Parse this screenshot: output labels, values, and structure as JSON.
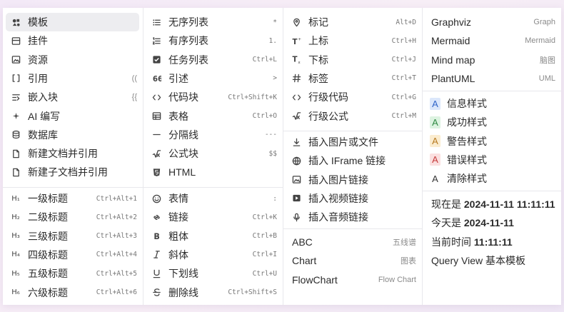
{
  "col1": {
    "block_items": [
      {
        "name": "template",
        "icon": "template-icon",
        "label": "模板",
        "hint": ""
      },
      {
        "name": "widget",
        "icon": "widget-icon",
        "label": "挂件",
        "hint": ""
      },
      {
        "name": "asset",
        "icon": "image-icon",
        "label": "资源",
        "hint": ""
      },
      {
        "name": "ref",
        "icon": "brackets-icon",
        "label": "引用",
        "hint": "(("
      },
      {
        "name": "embed",
        "icon": "embed-icon",
        "label": "嵌入块",
        "hint": "{{"
      },
      {
        "name": "ai",
        "icon": "sparkle-icon",
        "label": "AI 编写",
        "hint": ""
      },
      {
        "name": "database",
        "icon": "database-icon",
        "label": "数据库",
        "hint": ""
      },
      {
        "name": "new-doc-ref",
        "icon": "document-icon",
        "label": "新建文档并引用",
        "hint": ""
      },
      {
        "name": "new-subdoc-ref",
        "icon": "document-icon",
        "label": "新建子文档并引用",
        "hint": ""
      }
    ],
    "headings": [
      {
        "glyph": "H₁",
        "label": "一级标题",
        "shortcut": "Ctrl+Alt+1"
      },
      {
        "glyph": "H₂",
        "label": "二级标题",
        "shortcut": "Ctrl+Alt+2"
      },
      {
        "glyph": "H₃",
        "label": "三级标题",
        "shortcut": "Ctrl+Alt+3"
      },
      {
        "glyph": "H₄",
        "label": "四级标题",
        "shortcut": "Ctrl+Alt+4"
      },
      {
        "glyph": "H₅",
        "label": "五级标题",
        "shortcut": "Ctrl+Alt+5"
      },
      {
        "glyph": "H₆",
        "label": "六级标题",
        "shortcut": "Ctrl+Alt+6"
      }
    ]
  },
  "col2": {
    "blocks": [
      {
        "name": "unordered-list",
        "icon": "list-icon",
        "label": "无序列表",
        "shortcut": "*"
      },
      {
        "name": "ordered-list",
        "icon": "ordered-list-icon",
        "label": "有序列表",
        "shortcut": "1."
      },
      {
        "name": "task-list",
        "icon": "checkbox-icon",
        "label": "任务列表",
        "shortcut": "Ctrl+L"
      },
      {
        "name": "quote",
        "icon": "quote-icon",
        "label": "引述",
        "shortcut": ">"
      },
      {
        "name": "code-block",
        "icon": "code-icon",
        "label": "代码块",
        "shortcut": "Ctrl+Shift+K"
      },
      {
        "name": "table",
        "icon": "table-icon",
        "label": "表格",
        "shortcut": "Ctrl+O"
      },
      {
        "name": "divider",
        "icon": "divider-icon",
        "label": "分隔线",
        "shortcut": "---"
      },
      {
        "name": "math-block",
        "icon": "math-icon",
        "label": "公式块",
        "shortcut": "$$"
      },
      {
        "name": "html",
        "icon": "html-icon",
        "label": "HTML",
        "shortcut": ""
      }
    ],
    "inline": [
      {
        "name": "emoji",
        "icon": "emoji-icon",
        "label": "表情",
        "shortcut": ":"
      },
      {
        "name": "link",
        "icon": "link-icon",
        "label": "链接",
        "shortcut": "Ctrl+K"
      },
      {
        "name": "bold",
        "icon": "bold-icon",
        "label": "粗体",
        "shortcut": "Ctrl+B"
      },
      {
        "name": "italic",
        "icon": "italic-icon",
        "label": "斜体",
        "shortcut": "Ctrl+I"
      },
      {
        "name": "underline",
        "icon": "underline-icon",
        "label": "下划线",
        "shortcut": "Ctrl+U"
      },
      {
        "name": "strikethrough",
        "icon": "strikethrough-icon",
        "label": "删除线",
        "shortcut": "Ctrl+Shift+S"
      }
    ]
  },
  "col3": {
    "inline": [
      {
        "name": "mark",
        "icon": "marker-icon",
        "label": "标记",
        "shortcut": "Alt+D"
      },
      {
        "name": "superscript",
        "icon": "superscript-icon",
        "label": "上标",
        "shortcut": "Ctrl+H"
      },
      {
        "name": "subscript",
        "icon": "subscript-icon",
        "label": "下标",
        "shortcut": "Ctrl+J"
      },
      {
        "name": "tag",
        "icon": "hash-icon",
        "label": "标签",
        "shortcut": "Ctrl+T"
      },
      {
        "name": "inline-code",
        "icon": "code-icon",
        "label": "行级代码",
        "shortcut": "Ctrl+G"
      },
      {
        "name": "inline-math",
        "icon": "math-icon",
        "label": "行级公式",
        "shortcut": "Ctrl+M"
      }
    ],
    "media": [
      {
        "name": "insert-image-file",
        "icon": "download-icon",
        "label": "插入图片或文件"
      },
      {
        "name": "insert-iframe",
        "icon": "globe-icon",
        "label": "插入 IFrame 链接"
      },
      {
        "name": "insert-image-link",
        "icon": "image-icon",
        "label": "插入图片链接"
      },
      {
        "name": "insert-video-link",
        "icon": "video-icon",
        "label": "插入视频链接"
      },
      {
        "name": "insert-audio-link",
        "icon": "microphone-icon",
        "label": "插入音频链接"
      }
    ],
    "charts": [
      {
        "name": "abc",
        "label": "ABC",
        "hint": "五线谱"
      },
      {
        "name": "chart",
        "label": "Chart",
        "hint": "图表"
      },
      {
        "name": "flowchart",
        "label": "FlowChart",
        "hint": "Flow Chart"
      }
    ]
  },
  "col4": {
    "diagrams": [
      {
        "name": "graphviz",
        "label": "Graphviz",
        "hint": "Graph"
      },
      {
        "name": "mermaid",
        "label": "Mermaid",
        "hint": "Mermaid"
      },
      {
        "name": "mindmap",
        "label": "Mind map",
        "hint": "脑图"
      },
      {
        "name": "plantuml",
        "label": "PlantUML",
        "hint": "UML"
      }
    ],
    "styles": [
      {
        "name": "info-style",
        "badge": "A",
        "cls": "b-info",
        "label": "信息样式"
      },
      {
        "name": "success-style",
        "badge": "A",
        "cls": "b-success",
        "label": "成功样式"
      },
      {
        "name": "warning-style",
        "badge": "A",
        "cls": "b-warning",
        "label": "警告样式"
      },
      {
        "name": "error-style",
        "badge": "A",
        "cls": "b-error",
        "label": "错误样式"
      },
      {
        "name": "clear-style",
        "badge": "A",
        "cls": "b-clear",
        "label": "清除样式"
      }
    ],
    "dates": [
      {
        "name": "now",
        "prefix": "现在是 ",
        "value": "2024-11-11 11:11:11"
      },
      {
        "name": "today",
        "prefix": "今天是 ",
        "value": "2024-11-11"
      },
      {
        "name": "current-time",
        "prefix": "当前时间 ",
        "value": "11:11:11"
      }
    ],
    "query_view": "Query View 基本模板"
  },
  "colors": {
    "info": "#2f64c8",
    "success": "#2f8a43",
    "warning": "#b7791f",
    "error": "#c53b3b",
    "active_bg": "#ededf0"
  }
}
